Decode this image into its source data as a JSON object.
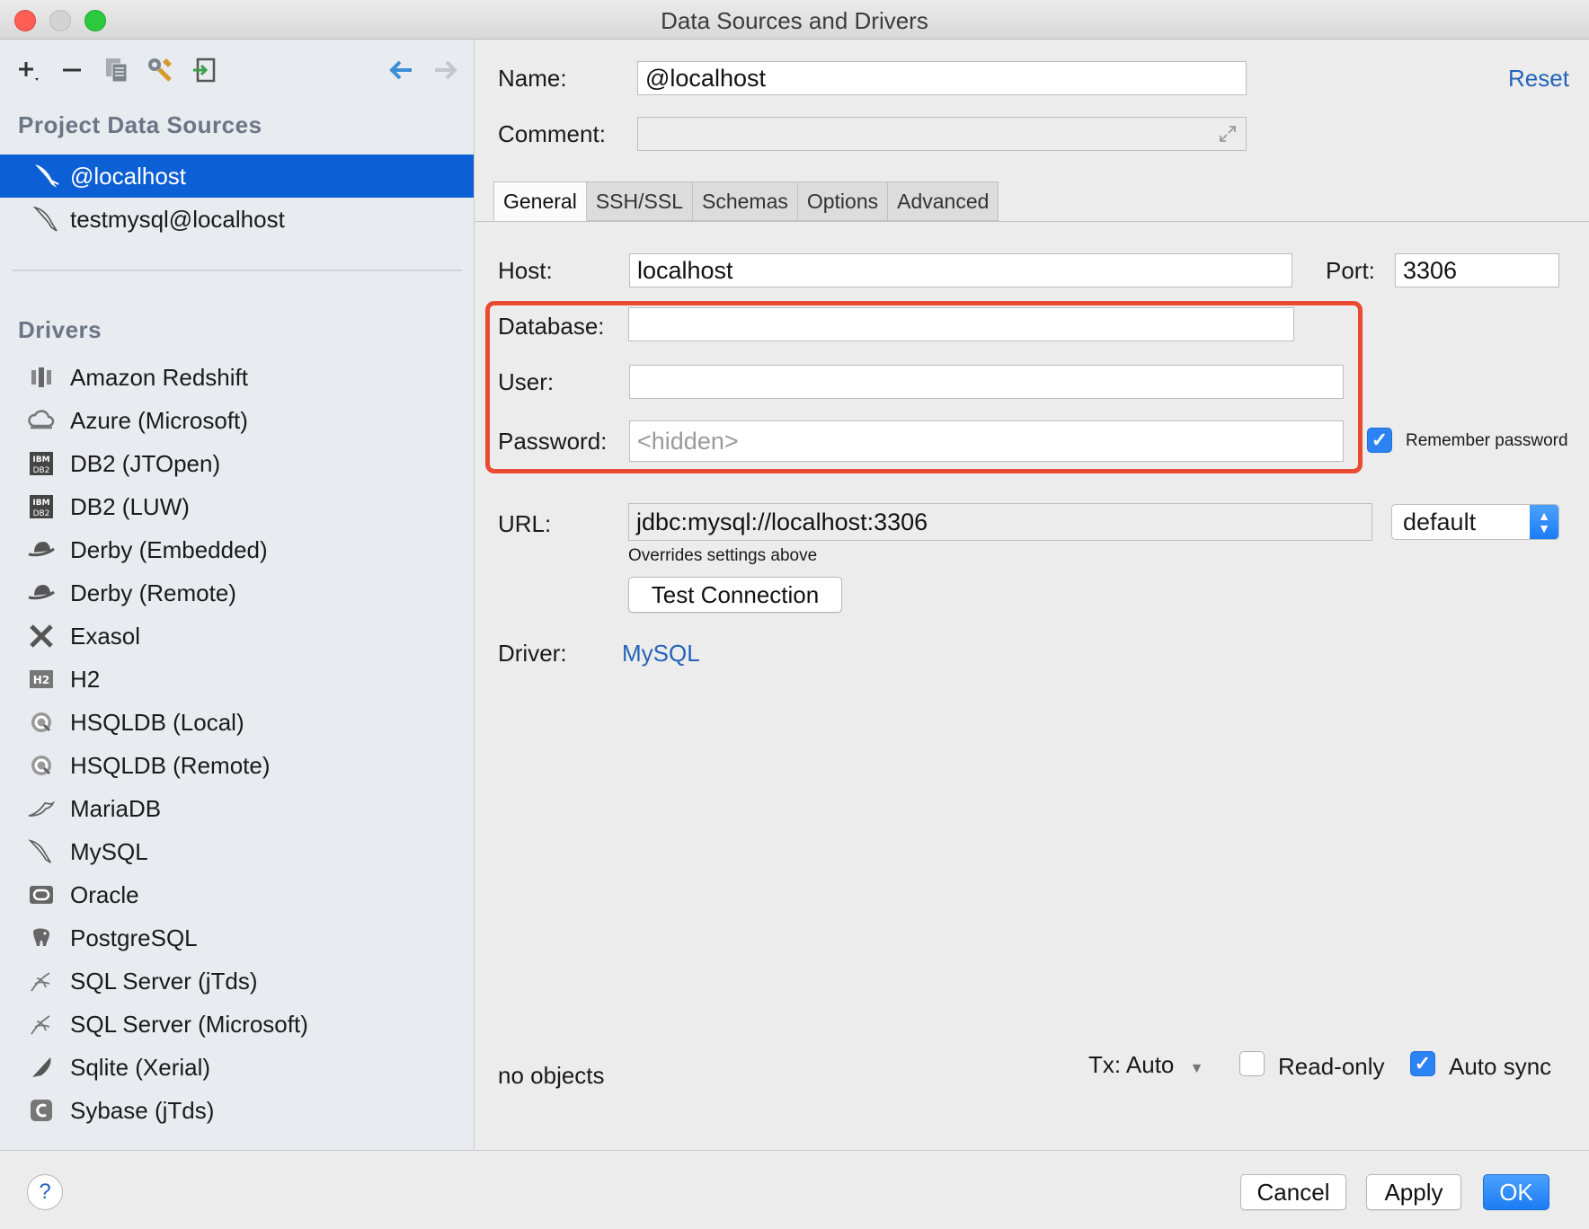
{
  "window": {
    "title": "Data Sources and Drivers"
  },
  "sidebar": {
    "project_title": "Project Data Sources",
    "data_sources": [
      {
        "label": "@localhost",
        "icon": "mysql-dolphin-icon"
      },
      {
        "label": "testmysql@localhost",
        "icon": "mysql-dolphin-icon"
      }
    ],
    "drivers_title": "Drivers",
    "drivers": [
      {
        "label": "Amazon Redshift",
        "icon": "redshift-icon"
      },
      {
        "label": "Azure (Microsoft)",
        "icon": "azure-cloud-icon"
      },
      {
        "label": "DB2 (JTOpen)",
        "icon": "ibm-db2-icon"
      },
      {
        "label": "DB2 (LUW)",
        "icon": "ibm-db2-icon"
      },
      {
        "label": "Derby (Embedded)",
        "icon": "derby-hat-icon"
      },
      {
        "label": "Derby (Remote)",
        "icon": "derby-hat-icon"
      },
      {
        "label": "Exasol",
        "icon": "exasol-x-icon"
      },
      {
        "label": "H2",
        "icon": "h2-icon"
      },
      {
        "label": "HSQLDB (Local)",
        "icon": "hsqldb-icon"
      },
      {
        "label": "HSQLDB (Remote)",
        "icon": "hsqldb-icon"
      },
      {
        "label": "MariaDB",
        "icon": "mariadb-seal-icon"
      },
      {
        "label": "MySQL",
        "icon": "mysql-dolphin-icon"
      },
      {
        "label": "Oracle",
        "icon": "oracle-icon"
      },
      {
        "label": "PostgreSQL",
        "icon": "postgresql-elephant-icon"
      },
      {
        "label": "SQL Server (jTds)",
        "icon": "sqlserver-icon"
      },
      {
        "label": "SQL Server (Microsoft)",
        "icon": "sqlserver-icon"
      },
      {
        "label": "Sqlite (Xerial)",
        "icon": "sqlite-feather-icon"
      },
      {
        "label": "Sybase (jTds)",
        "icon": "sybase-icon"
      }
    ]
  },
  "form": {
    "name_label": "Name:",
    "name_value": "@localhost",
    "comment_label": "Comment:",
    "comment_value": "",
    "reset_label": "Reset",
    "tabs": [
      "General",
      "SSH/SSL",
      "Schemas",
      "Options",
      "Advanced"
    ],
    "active_tab": "General",
    "host_label": "Host:",
    "host_value": "localhost",
    "port_label": "Port:",
    "port_value": "3306",
    "database_label": "Database:",
    "database_value": "",
    "user_label": "User:",
    "user_value": "",
    "password_label": "Password:",
    "password_placeholder": "<hidden>",
    "remember_password_label": "Remember password",
    "remember_password_checked": true,
    "url_label": "URL:",
    "url_value": "jdbc:mysql://localhost:3306",
    "url_mode": "default",
    "url_hint": "Overrides settings above",
    "test_connection_label": "Test Connection",
    "driver_label": "Driver:",
    "driver_value": "MySQL"
  },
  "status": {
    "objects": "no objects",
    "tx_label": "Tx: Auto",
    "read_only_label": "Read-only",
    "read_only_checked": false,
    "auto_sync_label": "Auto sync",
    "auto_sync_checked": true
  },
  "footer": {
    "help_label": "?",
    "cancel_label": "Cancel",
    "apply_label": "Apply",
    "ok_label": "OK"
  },
  "colors": {
    "selection": "#0d5fd6",
    "accent": "#2c83f3",
    "link": "#2463b8",
    "highlight_border": "#ea4a30"
  }
}
